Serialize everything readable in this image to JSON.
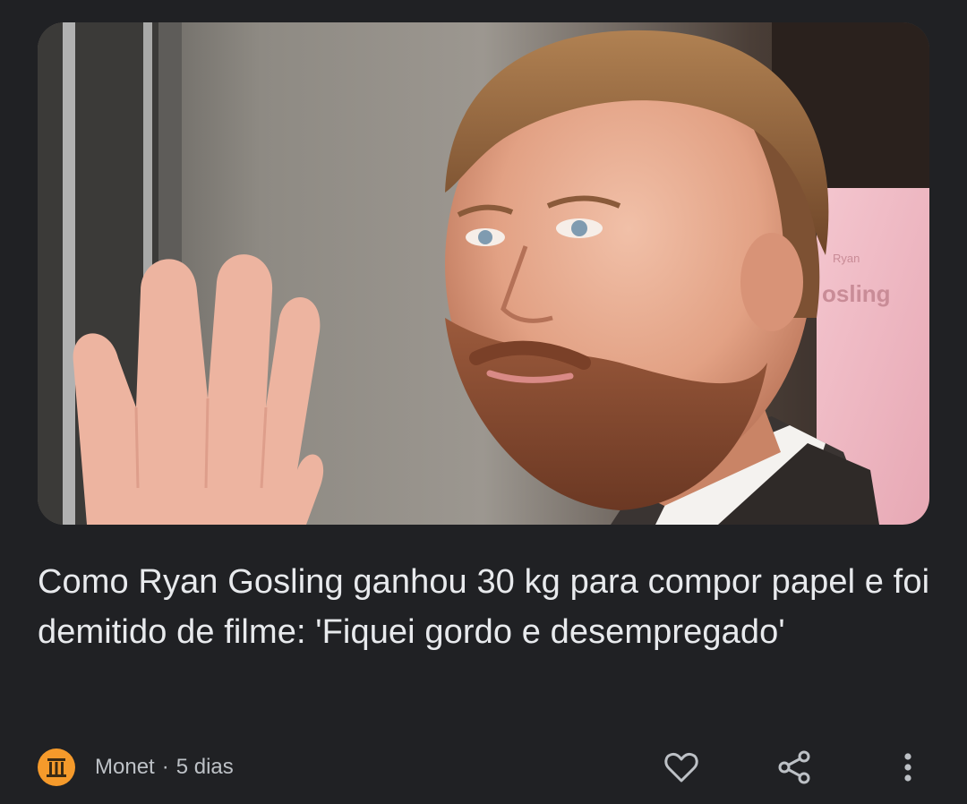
{
  "article": {
    "headline": "Como Ryan Gosling ganhou 30 kg para compor papel e foi demitido de filme: 'Fiquei gordo e desempregado'",
    "image_alt": "Ryan Gosling",
    "image_sign_text_top": "Ryan",
    "image_sign_text": "osling"
  },
  "meta": {
    "publisher": "Monet",
    "separator": "·",
    "age": "5 dias"
  },
  "actions": {
    "like_icon": "heart-outline",
    "share_icon": "share-nodes",
    "more_icon": "more-vertical"
  },
  "colors": {
    "background": "#202124",
    "text_primary": "#e8eaed",
    "text_secondary": "#bdc1c6",
    "publisher_logo": "#f59a2b"
  }
}
